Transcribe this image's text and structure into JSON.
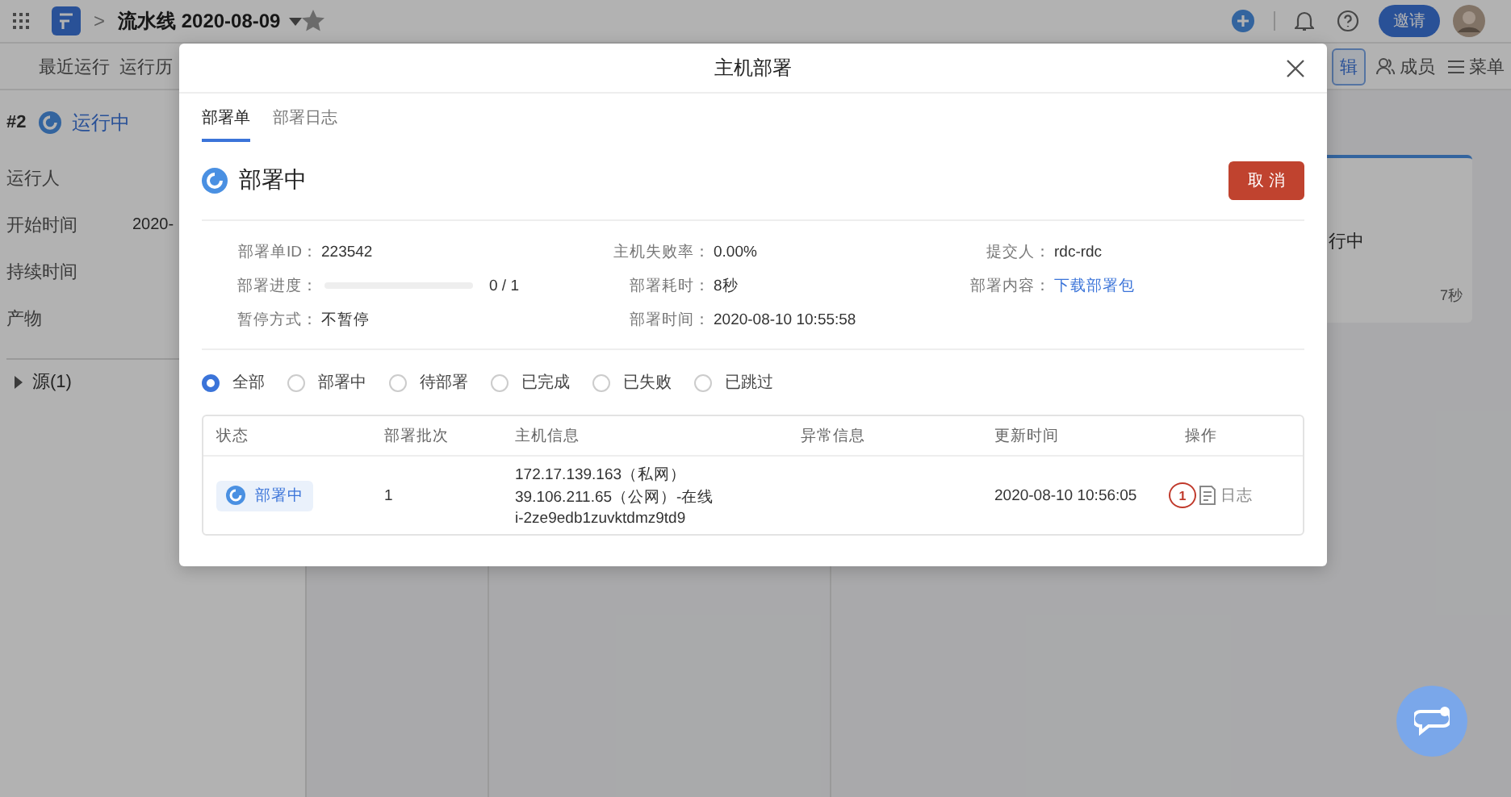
{
  "topbar": {
    "title": "流水线 2020-08-09",
    "starred": false,
    "separator": ">",
    "invite_button": "邀请"
  },
  "subnav": {
    "tabs": [
      {
        "label": "最近运行",
        "selected": false
      },
      {
        "label": "运行历",
        "selected": false
      }
    ],
    "edit_button": "辑",
    "members_button": "成员",
    "menu_button": "菜单"
  },
  "run_panel": {
    "number": "#2",
    "status": "运行中",
    "fields": [
      {
        "label": "运行人"
      },
      {
        "label": "开始时间",
        "value": "2020-"
      },
      {
        "label": "持续时间"
      },
      {
        "label": "产物"
      }
    ],
    "source": {
      "label": "源(1)",
      "expanded": false
    }
  },
  "stage_card": {
    "status": "行中",
    "duration": "7秒"
  },
  "dialog": {
    "title": "主机部署",
    "tabs": [
      {
        "label": "部署单",
        "selected": true
      },
      {
        "label": "部署日志",
        "selected": false
      }
    ],
    "status": "部署中",
    "cancel_button": "取 消",
    "info": [
      {
        "label": "部署单ID：",
        "value": "223542"
      },
      {
        "label": "主机失败率：",
        "value": "0.00%"
      },
      {
        "label": "提交人：",
        "value": "rdc-rdc"
      },
      {
        "label": "部署进度：",
        "kind": "progress",
        "level": 0,
        "value": "0 / 1"
      },
      {
        "label": "部署耗时：",
        "value": "8秒"
      },
      {
        "label": "部署内容：",
        "kind": "link",
        "value": "下载部署包"
      },
      {
        "label": "暂停方式：",
        "value": "不暂停"
      },
      {
        "label": "部署时间：",
        "value": "2020-08-10 10:55:58"
      }
    ],
    "filters": [
      {
        "label": "全部",
        "selected": true
      },
      {
        "label": "部署中",
        "selected": false
      },
      {
        "label": "待部署",
        "selected": false
      },
      {
        "label": "已完成",
        "selected": false
      },
      {
        "label": "已失败",
        "selected": false
      },
      {
        "label": "已跳过",
        "selected": false
      }
    ],
    "table": {
      "columns": [
        "状态",
        "部署批次",
        "主机信息",
        "异常信息",
        "更新时间",
        "操作"
      ],
      "rows": [
        {
          "status": "部署中",
          "batch": "1",
          "host": [
            "172.17.139.163（私网）",
            "39.106.211.65（公网）-在线",
            "i-2ze9edb1zuvktdmz9td9"
          ],
          "updated": "2020-08-10 10:56:05",
          "annotation": "1",
          "action": "日志"
        }
      ]
    }
  }
}
